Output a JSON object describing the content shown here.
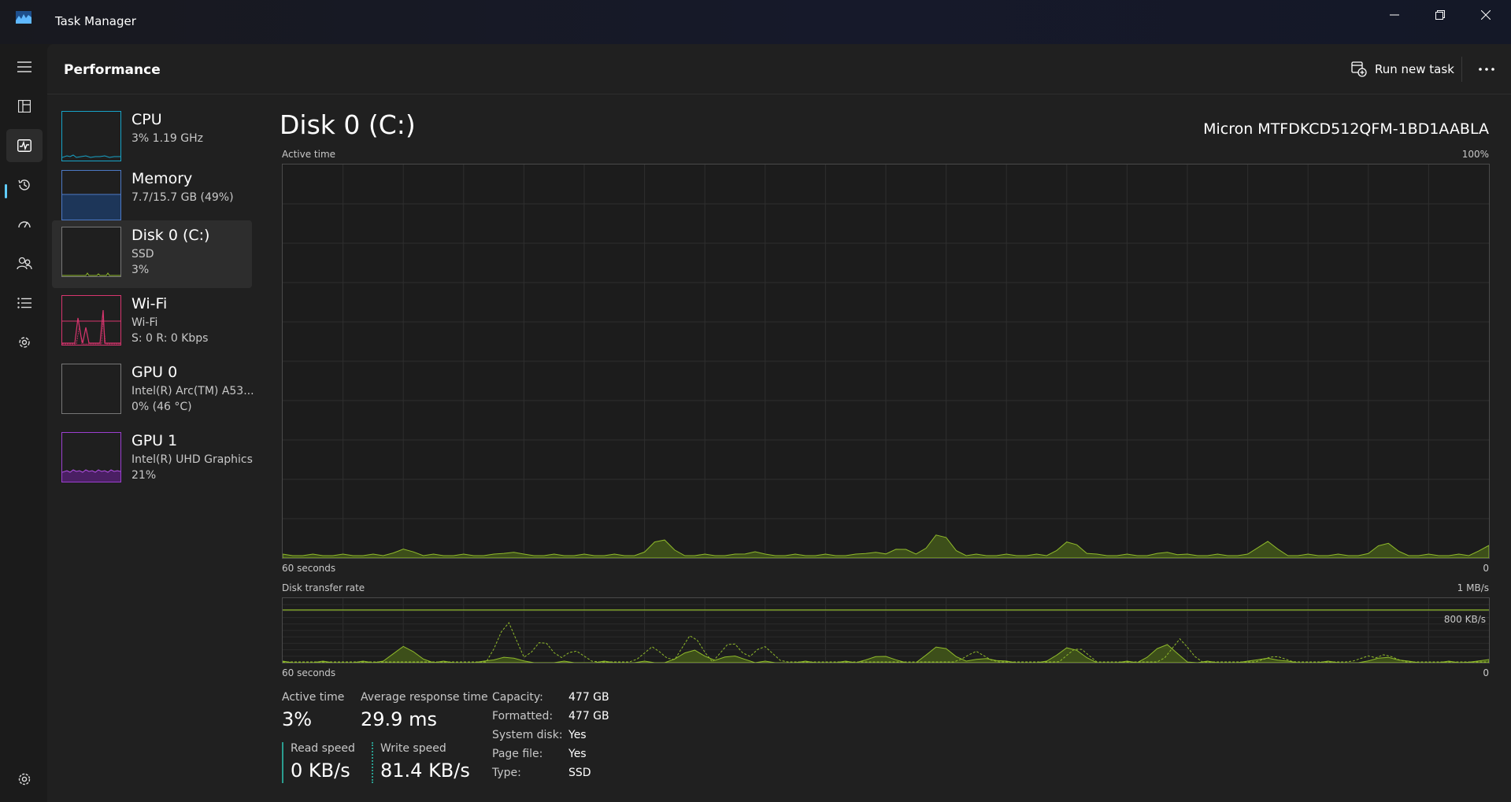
{
  "window": {
    "title": "Task Manager"
  },
  "header": {
    "page_title": "Performance",
    "run_new_task": "Run new task"
  },
  "nav": {
    "items": [
      {
        "name": "hamburger-menu-icon"
      },
      {
        "name": "processes-icon"
      },
      {
        "name": "performance-icon",
        "active": true
      },
      {
        "name": "app-history-icon"
      },
      {
        "name": "startup-apps-icon"
      },
      {
        "name": "users-icon"
      },
      {
        "name": "details-icon"
      },
      {
        "name": "services-icon"
      }
    ],
    "settings": "gear-icon"
  },
  "devices": [
    {
      "name": "CPU",
      "line2": "3%  1.19 GHz",
      "line3": "",
      "color": "#17a3c7"
    },
    {
      "name": "Memory",
      "line2": "7.7/15.7 GB (49%)",
      "line3": "",
      "color": "#4c79c5"
    },
    {
      "name": "Disk 0 (C:)",
      "line2": "SSD",
      "line3": "3%",
      "color": "#8fb92b",
      "selected": true
    },
    {
      "name": "Wi-Fi",
      "line2": "Wi-Fi",
      "line3": "S: 0 R: 0 Kbps",
      "color": "#d7356e"
    },
    {
      "name": "GPU 0",
      "line2": "Intel(R) Arc(TM) A53...",
      "line3": "0%  (46 °C)",
      "color": "#9c3fd1"
    },
    {
      "name": "GPU 1",
      "line2": "Intel(R) UHD Graphics",
      "line3": "21%",
      "color": "#9c3fd1"
    }
  ],
  "detail": {
    "title": "Disk 0 (C:)",
    "model": "Micron MTFDKCD512QFM-1BD1AABLA",
    "active_time_graph": {
      "label": "Active time",
      "max_label": "100%",
      "x_left": "60 seconds",
      "x_right": "0"
    },
    "transfer_graph": {
      "label": "Disk transfer rate",
      "max_label": "1 MB/s",
      "line_label": "800 KB/s",
      "x_left": "60 seconds",
      "x_right": "0"
    },
    "stats": {
      "active_time_label": "Active time",
      "active_time_value": "3%",
      "avg_response_label": "Average response time",
      "avg_response_value": "29.9 ms",
      "read_speed_label": "Read speed",
      "read_speed_value": "0 KB/s",
      "write_speed_label": "Write speed",
      "write_speed_value": "81.4 KB/s"
    },
    "properties": [
      {
        "key": "Capacity:",
        "value": "477 GB"
      },
      {
        "key": "Formatted:",
        "value": "477 GB"
      },
      {
        "key": "System disk:",
        "value": "Yes"
      },
      {
        "key": "Page file:",
        "value": "Yes"
      },
      {
        "key": "Type:",
        "value": "SSD"
      }
    ]
  },
  "colors": {
    "disk_accent": "#8fb92b",
    "read_bar": "#2a9d8f",
    "write_bar": "#8fb92b"
  }
}
